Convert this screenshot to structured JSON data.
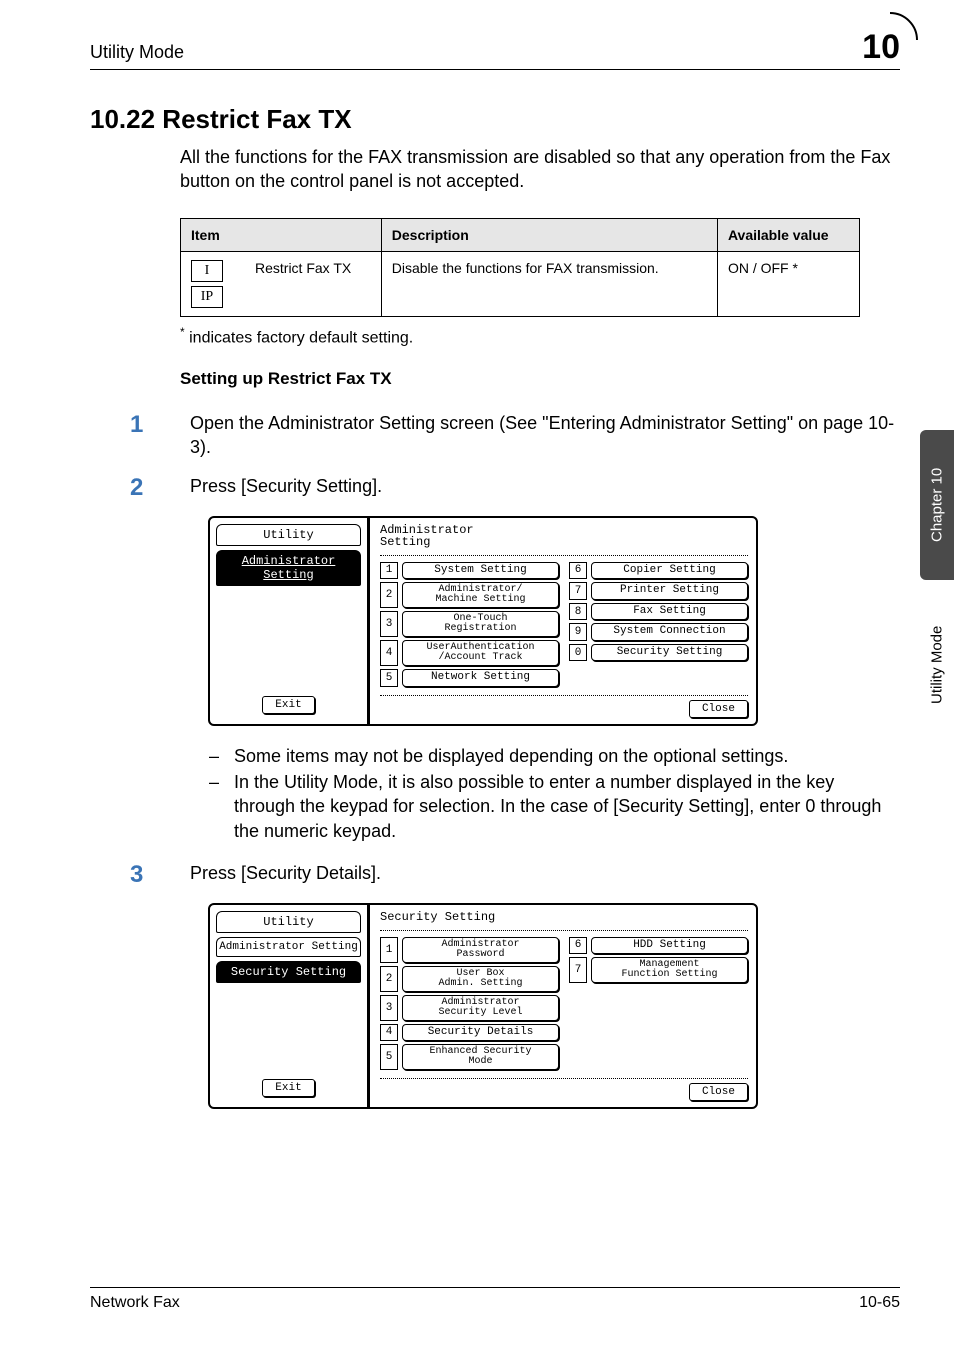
{
  "header": {
    "section": "Utility Mode",
    "chapter_number": "10"
  },
  "section_title": "10.22  Restrict Fax TX",
  "intro_para": "All the functions for the FAX transmission are disabled so that any operation from the Fax button on the control panel is not accepted.",
  "table": {
    "headers": {
      "item": "Item",
      "desc": "Description",
      "avail": "Available value"
    },
    "row": {
      "icons": [
        "I",
        "IP"
      ],
      "name": "Restrict Fax TX",
      "desc": "Disable the functions for FAX transmission.",
      "avail": "ON / OFF *"
    }
  },
  "footnote_marker": "*",
  "footnote": " indicates factory default setting.",
  "sub_heading": "Setting up Restrict Fax TX",
  "steps": {
    "s1": "Open the Administrator Setting screen (See \"Entering Administrator Setting\" on page 10-3).",
    "s2": "Press [Security Setting].",
    "s3": "Press [Security Details]."
  },
  "lcd1": {
    "left_tab1": "Utility",
    "left_tab2": "Administrator\nSetting",
    "exit": "Exit",
    "heading": "Administrator\nSetting",
    "left_items": [
      {
        "n": "1",
        "l": "System Setting"
      },
      {
        "n": "2",
        "l": "Administrator/\nMachine Setting"
      },
      {
        "n": "3",
        "l": "One-Touch\nRegistration"
      },
      {
        "n": "4",
        "l": "UserAuthentication\n/Account Track"
      },
      {
        "n": "5",
        "l": "Network Setting"
      }
    ],
    "right_items": [
      {
        "n": "6",
        "l": "Copier Setting"
      },
      {
        "n": "7",
        "l": "Printer Setting"
      },
      {
        "n": "8",
        "l": "Fax Setting"
      },
      {
        "n": "9",
        "l": "System Connection"
      },
      {
        "n": "0",
        "l": "Security Setting"
      }
    ],
    "close": "Close"
  },
  "notes": {
    "n1": "Some items may not be displayed depending on the optional settings.",
    "n2": "In the Utility Mode, it is also possible to enter a number displayed in the key through the keypad for selection. In the case of [Security Setting], enter 0 through the numeric keypad."
  },
  "lcd2": {
    "left_tab1": "Utility",
    "left_tab2": "Administrator\nSetting",
    "left_tab3": "Security Setting",
    "exit": "Exit",
    "heading": "Security Setting",
    "left_items": [
      {
        "n": "1",
        "l": "Administrator\nPassword"
      },
      {
        "n": "2",
        "l": "User Box\nAdmin. Setting"
      },
      {
        "n": "3",
        "l": "Administrator\nSecurity Level"
      },
      {
        "n": "4",
        "l": "Security Details"
      },
      {
        "n": "5",
        "l": "Enhanced Security\nMode"
      }
    ],
    "right_items": [
      {
        "n": "6",
        "l": "HDD Setting"
      },
      {
        "n": "7",
        "l": "Management\nFunction Setting"
      }
    ],
    "close": "Close"
  },
  "sidetab": {
    "dark": "Chapter 10",
    "light": "Utility Mode"
  },
  "footer": {
    "left": "Network Fax",
    "right": "10-65"
  }
}
